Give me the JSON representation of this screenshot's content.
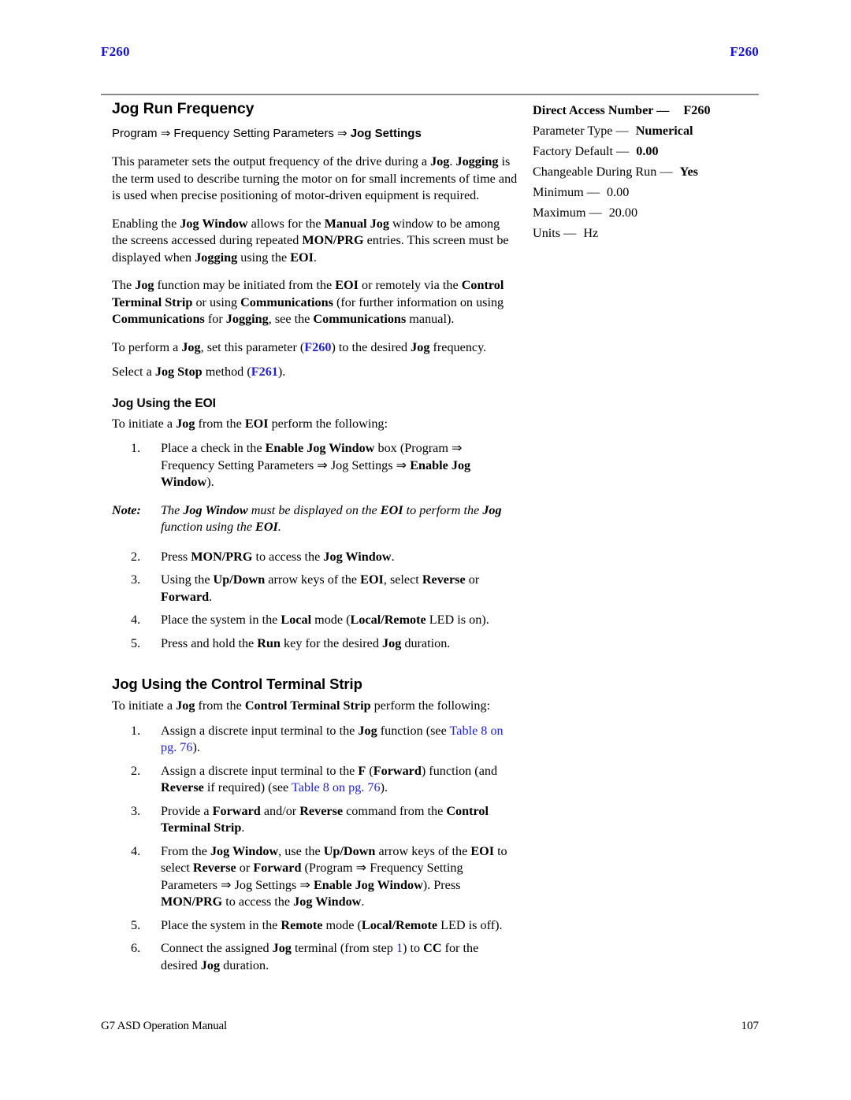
{
  "header": {
    "left_label": "F260",
    "right_label": "F260",
    "link_color": "#1414d2"
  },
  "footer": {
    "manual_title": "G7 ASD Operation Manual",
    "page_number": "107"
  },
  "main": {
    "title": "Jog Run Frequency",
    "breadcrumb": {
      "part1": "Program ",
      "arrow1": "⇒",
      "part2": " Frequency Setting Parameters ",
      "arrow2": "⇒",
      "part3": " Jog Settings"
    },
    "paragraphs": [
      {
        "id": "intro",
        "runs": [
          {
            "t": "This parameter sets the output frequency of the drive during a ",
            "s": "n"
          },
          {
            "t": "Jog",
            "s": "b"
          },
          {
            "t": ". ",
            "s": "n"
          },
          {
            "t": "Jogging",
            "s": "b"
          },
          {
            "t": " is the term used to describe turning the motor on for small increments of time and is used when precise positioning of motor-driven equipment is required.",
            "s": "n"
          }
        ]
      },
      {
        "id": "jog-window",
        "runs": [
          {
            "t": "Enabling the ",
            "s": "n"
          },
          {
            "t": "Jog Window",
            "s": "b"
          },
          {
            "t": " allows for the ",
            "s": "n"
          },
          {
            "t": "Manual Jog",
            "s": "b"
          },
          {
            "t": " window to be among the screens accessed during repeated ",
            "s": "n"
          },
          {
            "t": "MON/PRG",
            "s": "b"
          },
          {
            "t": " entries. This screen must be displayed when ",
            "s": "n"
          },
          {
            "t": "Jogging",
            "s": "b"
          },
          {
            "t": " using the ",
            "s": "n"
          },
          {
            "t": "EOI",
            "s": "b"
          },
          {
            "t": ".",
            "s": "n"
          }
        ]
      },
      {
        "id": "jog-initiation",
        "runs": [
          {
            "t": "The ",
            "s": "n"
          },
          {
            "t": "Jog",
            "s": "b"
          },
          {
            "t": " function may be initiated from the ",
            "s": "n"
          },
          {
            "t": "EOI",
            "s": "b"
          },
          {
            "t": " or remotely via the ",
            "s": "n"
          },
          {
            "t": "Control Terminal Strip",
            "s": "b"
          },
          {
            "t": " or using ",
            "s": "n"
          },
          {
            "t": "Communications",
            "s": "b"
          },
          {
            "t": " (for further information on using ",
            "s": "n"
          },
          {
            "t": "Communications",
            "s": "b"
          },
          {
            "t": " for ",
            "s": "n"
          },
          {
            "t": "Jogging",
            "s": "b"
          },
          {
            "t": ", see the ",
            "s": "n"
          },
          {
            "t": "Communications",
            "s": "b"
          },
          {
            "t": " manual).",
            "s": "n"
          }
        ]
      },
      {
        "id": "perform-jog",
        "runs": [
          {
            "t": "To perform a ",
            "s": "n"
          },
          {
            "t": "Jog",
            "s": "b"
          },
          {
            "t": ", set this parameter (",
            "s": "n"
          },
          {
            "t": "F260",
            "s": "lb"
          },
          {
            "t": ") to the desired ",
            "s": "n"
          },
          {
            "t": "Jog",
            "s": "b"
          },
          {
            "t": " frequency.",
            "s": "n"
          }
        ]
      },
      {
        "id": "jog-stop",
        "runs": [
          {
            "t": "Select a ",
            "s": "n"
          },
          {
            "t": "Jog Stop",
            "s": "b"
          },
          {
            "t": " method (",
            "s": "n"
          },
          {
            "t": "F261",
            "s": "lb"
          },
          {
            "t": ").",
            "s": "n"
          }
        ]
      }
    ],
    "section_eoi": {
      "heading": "Jog Using the EOI",
      "intro": [
        {
          "t": "To initiate a ",
          "s": "n"
        },
        {
          "t": "Jog",
          "s": "b"
        },
        {
          "t": " from the ",
          "s": "n"
        },
        {
          "t": "EOI",
          "s": "b"
        },
        {
          "t": " perform the following:",
          "s": "n"
        }
      ],
      "steps_before_note": [
        {
          "num": "1.",
          "runs": [
            {
              "t": "Place a check in the ",
              "s": "n"
            },
            {
              "t": "Enable Jog Window",
              "s": "b"
            },
            {
              "t": " box (Program ⇒ Frequency Setting Parameters ⇒ Jog Settings ⇒ ",
              "s": "n"
            },
            {
              "t": "Enable Jog Window",
              "s": "b"
            },
            {
              "t": ").",
              "s": "n"
            }
          ]
        }
      ],
      "note": {
        "label": "Note:",
        "runs": [
          {
            "t": "The ",
            "s": "n"
          },
          {
            "t": "Jog Window",
            "s": "b"
          },
          {
            "t": " must be displayed on the ",
            "s": "n"
          },
          {
            "t": "EOI",
            "s": "b"
          },
          {
            "t": " to perform the ",
            "s": "n"
          },
          {
            "t": "Jog",
            "s": "b"
          },
          {
            "t": " function using the ",
            "s": "n"
          },
          {
            "t": "EOI",
            "s": "b"
          },
          {
            "t": ".",
            "s": "n"
          }
        ]
      },
      "steps_after_note": [
        {
          "num": "2.",
          "runs": [
            {
              "t": "Press ",
              "s": "n"
            },
            {
              "t": "MON/PRG",
              "s": "b"
            },
            {
              "t": " to access the ",
              "s": "n"
            },
            {
              "t": "Jog Window",
              "s": "b"
            },
            {
              "t": ".",
              "s": "n"
            }
          ]
        },
        {
          "num": "3.",
          "runs": [
            {
              "t": "Using the ",
              "s": "n"
            },
            {
              "t": "Up/Down",
              "s": "b"
            },
            {
              "t": " arrow keys of the ",
              "s": "n"
            },
            {
              "t": "EOI",
              "s": "b"
            },
            {
              "t": ", select ",
              "s": "n"
            },
            {
              "t": "Reverse",
              "s": "b"
            },
            {
              "t": " or ",
              "s": "n"
            },
            {
              "t": "Forward",
              "s": "b"
            },
            {
              "t": ".",
              "s": "n"
            }
          ]
        },
        {
          "num": "4.",
          "runs": [
            {
              "t": "Place the system in the ",
              "s": "n"
            },
            {
              "t": "Local",
              "s": "b"
            },
            {
              "t": " mode (",
              "s": "n"
            },
            {
              "t": "Local/Remote",
              "s": "b"
            },
            {
              "t": " LED is on).",
              "s": "n"
            }
          ]
        },
        {
          "num": "5.",
          "runs": [
            {
              "t": "Press and hold the ",
              "s": "n"
            },
            {
              "t": "Run",
              "s": "b"
            },
            {
              "t": " key for the desired ",
              "s": "n"
            },
            {
              "t": "Jog",
              "s": "b"
            },
            {
              "t": " duration.",
              "s": "n"
            }
          ]
        }
      ]
    },
    "section_cts": {
      "heading": "Jog Using the Control Terminal Strip",
      "intro": [
        {
          "t": "To initiate a ",
          "s": "n"
        },
        {
          "t": "Jog",
          "s": "b"
        },
        {
          "t": " from the ",
          "s": "n"
        },
        {
          "t": "Control Terminal Strip",
          "s": "b"
        },
        {
          "t": " perform the following:",
          "s": "n"
        }
      ],
      "steps": [
        {
          "num": "1.",
          "runs": [
            {
              "t": "Assign a discrete input terminal to the ",
              "s": "n"
            },
            {
              "t": "Jog",
              "s": "b"
            },
            {
              "t": " function (see ",
              "s": "n"
            },
            {
              "t": "Table 8 on pg. 76",
              "s": "l"
            },
            {
              "t": ").",
              "s": "n"
            }
          ]
        },
        {
          "num": "2.",
          "runs": [
            {
              "t": "Assign a discrete input terminal to the ",
              "s": "n"
            },
            {
              "t": "F",
              "s": "b"
            },
            {
              "t": " (",
              "s": "n"
            },
            {
              "t": "Forward",
              "s": "b"
            },
            {
              "t": ") function (and ",
              "s": "n"
            },
            {
              "t": "Reverse",
              "s": "b"
            },
            {
              "t": " if required) (see ",
              "s": "n"
            },
            {
              "t": "Table 8 on pg. 76",
              "s": "l"
            },
            {
              "t": ").",
              "s": "n"
            }
          ]
        },
        {
          "num": "3.",
          "runs": [
            {
              "t": "Provide a ",
              "s": "n"
            },
            {
              "t": "Forward",
              "s": "b"
            },
            {
              "t": " and/or ",
              "s": "n"
            },
            {
              "t": "Reverse",
              "s": "b"
            },
            {
              "t": " command from the ",
              "s": "n"
            },
            {
              "t": "Control Terminal Strip",
              "s": "b"
            },
            {
              "t": ".",
              "s": "n"
            }
          ]
        },
        {
          "num": "4.",
          "runs": [
            {
              "t": "From the ",
              "s": "n"
            },
            {
              "t": "Jog Window",
              "s": "b"
            },
            {
              "t": ", use the ",
              "s": "n"
            },
            {
              "t": "Up/Down",
              "s": "b"
            },
            {
              "t": " arrow keys of the ",
              "s": "n"
            },
            {
              "t": "EOI",
              "s": "b"
            },
            {
              "t": " to select ",
              "s": "n"
            },
            {
              "t": "Reverse",
              "s": "b"
            },
            {
              "t": " or ",
              "s": "n"
            },
            {
              "t": "Forward",
              "s": "b"
            },
            {
              "t": " (Program ⇒ Frequency Setting Parameters ⇒ Jog Settings ⇒ ",
              "s": "n"
            },
            {
              "t": "Enable Jog Window",
              "s": "b"
            },
            {
              "t": "). Press ",
              "s": "n"
            },
            {
              "t": "MON/PRG",
              "s": "b"
            },
            {
              "t": " to access the ",
              "s": "n"
            },
            {
              "t": "Jog Window",
              "s": "b"
            },
            {
              "t": ".",
              "s": "n"
            }
          ]
        },
        {
          "num": "5.",
          "runs": [
            {
              "t": "Place the system in the ",
              "s": "n"
            },
            {
              "t": "Remote",
              "s": "b"
            },
            {
              "t": " mode (",
              "s": "n"
            },
            {
              "t": "Local/Remote",
              "s": "b"
            },
            {
              "t": " LED is off).",
              "s": "n"
            }
          ]
        },
        {
          "num": "6.",
          "runs": [
            {
              "t": "Connect the assigned ",
              "s": "n"
            },
            {
              "t": "Jog",
              "s": "b"
            },
            {
              "t": " terminal (from step ",
              "s": "n"
            },
            {
              "t": "1",
              "s": "l"
            },
            {
              "t": ") to ",
              "s": "n"
            },
            {
              "t": "CC",
              "s": "b"
            },
            {
              "t": " for the desired ",
              "s": "n"
            },
            {
              "t": "Jog",
              "s": "b"
            },
            {
              "t": " duration.",
              "s": "n"
            }
          ]
        }
      ]
    }
  },
  "sidebar": {
    "specs": [
      {
        "label": "Direct Access Number —",
        "value": "F260",
        "label_bold": true,
        "value_bold": true,
        "extra_gap": true
      },
      {
        "label": "Parameter Type —",
        "value": "Numerical",
        "label_bold": false,
        "value_bold": true,
        "extra_gap": false
      },
      {
        "label": "Factory Default —",
        "value": "0.00",
        "label_bold": false,
        "value_bold": true,
        "extra_gap": false
      },
      {
        "label": "Changeable During Run —",
        "value": "Yes",
        "label_bold": false,
        "value_bold": true,
        "extra_gap": false
      },
      {
        "label": "Minimum —",
        "value": "0.00",
        "label_bold": false,
        "value_bold": false,
        "extra_gap": false
      },
      {
        "label": "Maximum —",
        "value": "20.00",
        "label_bold": false,
        "value_bold": false,
        "extra_gap": false
      },
      {
        "label": "Units —",
        "value": "Hz",
        "label_bold": false,
        "value_bold": false,
        "extra_gap": false
      }
    ]
  }
}
